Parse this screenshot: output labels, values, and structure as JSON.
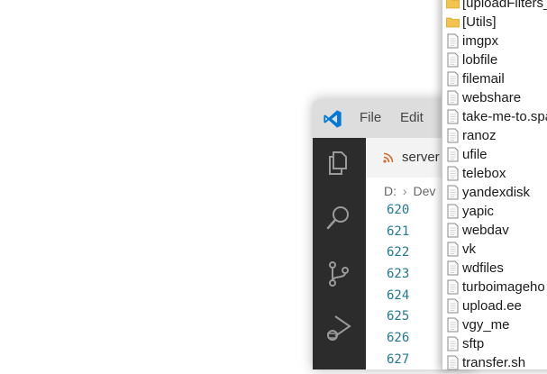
{
  "vscode": {
    "menu": {
      "file": "File",
      "edit": "Edit"
    },
    "tab": {
      "title": "server"
    },
    "breadcrumb": {
      "drive": "D:",
      "folder": "Dev"
    },
    "line_numbers": [
      "620",
      "621",
      "622",
      "623",
      "624",
      "625",
      "626",
      "627"
    ],
    "colors": {
      "accent": "#0078d4",
      "activity_bar": "#2c2c2c",
      "line_number": "#237893"
    }
  },
  "dropdown": {
    "items": [
      {
        "label": "[uploadFilters_",
        "icon": "folder-icon"
      },
      {
        "label": "[Utils]",
        "icon": "folder-icon"
      },
      {
        "label": "imgpx",
        "icon": "file-icon"
      },
      {
        "label": "lobfile",
        "icon": "file-icon"
      },
      {
        "label": "filemail",
        "icon": "file-icon"
      },
      {
        "label": "webshare",
        "icon": "file-icon"
      },
      {
        "label": "take-me-to.spa",
        "icon": "file-icon"
      },
      {
        "label": "ranoz",
        "icon": "file-icon"
      },
      {
        "label": "ufile",
        "icon": "file-icon"
      },
      {
        "label": "telebox",
        "icon": "file-icon"
      },
      {
        "label": "yandexdisk",
        "icon": "file-icon"
      },
      {
        "label": "yapic",
        "icon": "file-icon"
      },
      {
        "label": "webdav",
        "icon": "file-icon"
      },
      {
        "label": "vk",
        "icon": "file-icon"
      },
      {
        "label": "wdfiles",
        "icon": "file-icon"
      },
      {
        "label": "turboimageho",
        "icon": "file-icon"
      },
      {
        "label": "upload.ee",
        "icon": "file-icon"
      },
      {
        "label": "vgy_me",
        "icon": "file-icon"
      },
      {
        "label": "sftp",
        "icon": "file-icon"
      },
      {
        "label": "transfer.sh",
        "icon": "file-icon"
      }
    ]
  }
}
